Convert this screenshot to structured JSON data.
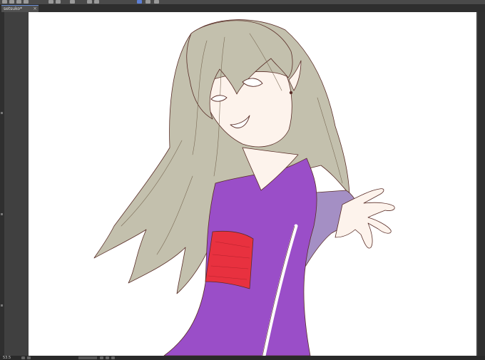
{
  "toolbar": {
    "tools": [
      {
        "icon": "undo-icon"
      },
      {
        "icon": "redo-icon"
      },
      {
        "icon": "save-icon"
      },
      {
        "icon": "new-file-icon"
      },
      {
        "icon": "rotate-left-icon"
      },
      {
        "icon": "rotate-right-icon"
      },
      {
        "icon": "transform-icon"
      },
      {
        "icon": "selection-icon"
      },
      {
        "icon": "fill-icon"
      },
      {
        "icon": "frame-icon"
      },
      {
        "icon": "layer-icon"
      },
      {
        "icon": "snap-icon"
      }
    ]
  },
  "document_tab": {
    "title": "setsuko*",
    "close_glyph": "×"
  },
  "status": {
    "zoom": "53.5"
  },
  "colors": {
    "accent": "#5c7fd6",
    "hair": "#c3c0ad",
    "lineart": "#5a2e28",
    "kimono": "#9a4ec8",
    "kimono_sleeve": "#a48fc4",
    "obi": "#e8313f",
    "skin": "#fdf3ec",
    "canvas": "#ffffff"
  }
}
